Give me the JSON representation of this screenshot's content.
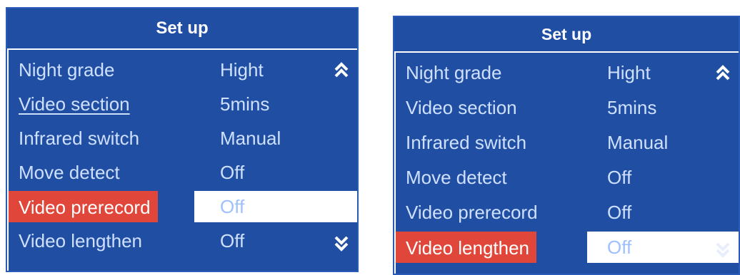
{
  "panels": [
    {
      "title": "Set up",
      "items": [
        {
          "label": "Night grade",
          "value": "Hight"
        },
        {
          "label": "Video section",
          "value": "5mins"
        },
        {
          "label": "Infrared switch",
          "value": "Manual"
        },
        {
          "label": "Move detect",
          "value": "Off"
        },
        {
          "label": "Video prerecord",
          "value": "Off"
        },
        {
          "label": "Video lengthen",
          "value": "Off"
        }
      ],
      "selected_index": 4,
      "focused_index": 1
    },
    {
      "title": "Set up",
      "items": [
        {
          "label": "Night grade",
          "value": "Hight"
        },
        {
          "label": "Video section",
          "value": "5mins"
        },
        {
          "label": "Infrared switch",
          "value": "Manual"
        },
        {
          "label": "Move detect",
          "value": "Off"
        },
        {
          "label": "Video prerecord",
          "value": "Off"
        },
        {
          "label": "Video lengthen",
          "value": "Off"
        }
      ],
      "selected_index": 5
    }
  ],
  "colors": {
    "panel_bg": "#1f4ea3",
    "text": "#cfe0ff",
    "highlight_label": "#e0473a",
    "highlight_value_bg": "#ffffff"
  },
  "icons": {
    "scroll_up": "double-chevron-up-icon",
    "scroll_down": "double-chevron-down-icon"
  }
}
